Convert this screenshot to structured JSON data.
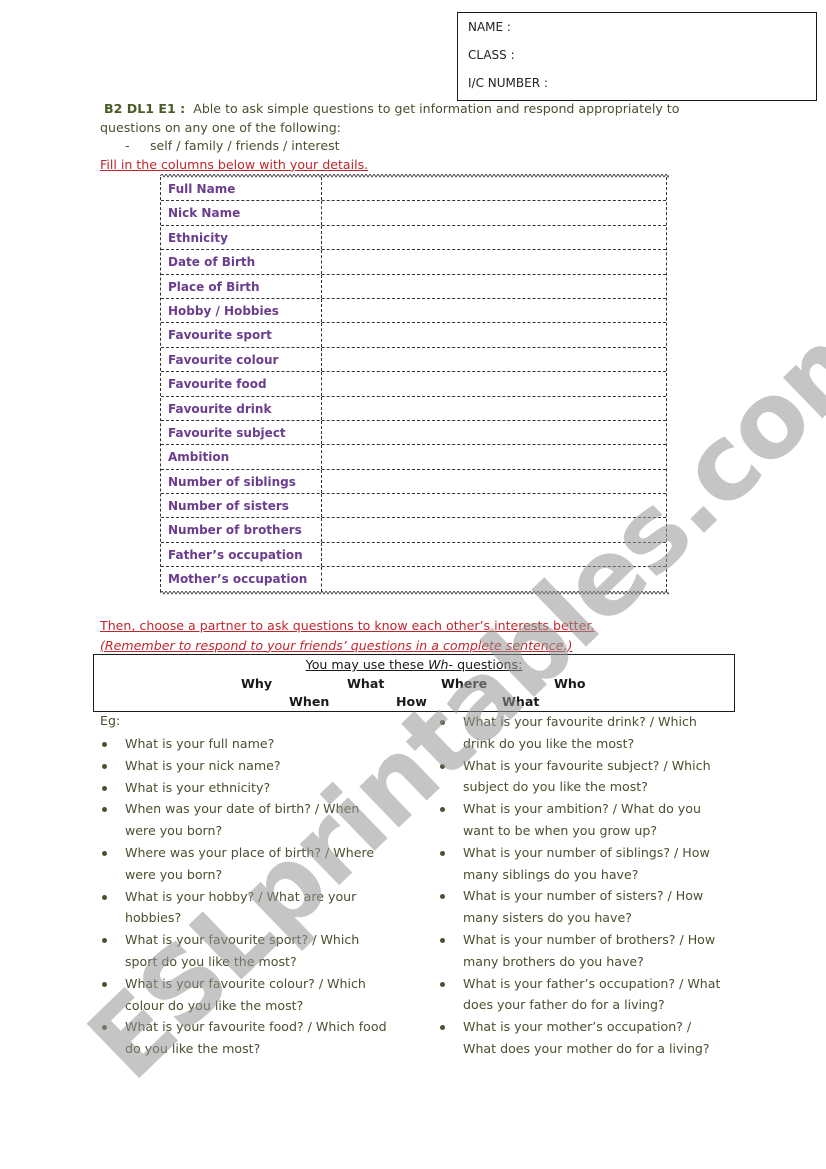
{
  "id_box": {
    "name_label": "NAME :",
    "class_label": "CLASS :",
    "ic_label": "I/C NUMBER :"
  },
  "intro": {
    "code": "B2 DL1 E1 :",
    "description": "Able to ask simple questions to get information and respond appropriately to questions on any one of the following:",
    "dash": "-",
    "topics": "self  / family / friends / interest",
    "instruction": "Fill in the columns below with your details."
  },
  "details_table": {
    "rows": [
      {
        "label": "Full Name",
        "value": ""
      },
      {
        "label": "Nick Name",
        "value": ""
      },
      {
        "label": "Ethnicity",
        "value": ""
      },
      {
        "label": "Date of Birth",
        "value": ""
      },
      {
        "label": "Place of Birth",
        "value": ""
      },
      {
        "label": "Hobby / Hobbies",
        "value": ""
      },
      {
        "label": "Favourite sport",
        "value": ""
      },
      {
        "label": "Favourite colour",
        "value": ""
      },
      {
        "label": "Favourite food",
        "value": ""
      },
      {
        "label": "Favourite drink",
        "value": ""
      },
      {
        "label": "Favourite subject",
        "value": ""
      },
      {
        "label": "Ambition",
        "value": ""
      },
      {
        "label": "Number of siblings",
        "value": ""
      },
      {
        "label": "Number of sisters",
        "value": ""
      },
      {
        "label": "Number of brothers",
        "value": ""
      },
      {
        "label": "Father’s occupation",
        "value": ""
      },
      {
        "label": "Mother’s occupation",
        "value": ""
      }
    ]
  },
  "partner": {
    "line1": "Then, choose a partner to ask questions to know each other’s interests better.",
    "line2": "(Remember to respond to your friends’ questions in a complete sentence.)"
  },
  "wh_box": {
    "title_prefix": "You may use these ",
    "title_em": "Wh",
    "title_suffix": "- questions:",
    "words": [
      "Why",
      "What",
      "Where",
      "Who",
      "When",
      "How",
      "What"
    ]
  },
  "examples": {
    "label": "Eg:",
    "left": [
      "What is your full name?",
      "What is your nick name?",
      "What is your ethnicity?",
      "When was your date of birth? / When were you born?",
      "Where was your place of birth? / Where were you born?",
      "What is your hobby? / What are your hobbies?",
      "What is your favourite sport? / Which sport do you like the most?",
      "What is your favourite colour? / Which colour do you like the most?",
      "What is your favourite food? / Which food do you like the most?"
    ],
    "right": [
      "What is your favourite drink? / Which drink do you like the most?",
      "What is your favourite subject? / Which subject do you like the most?",
      "What is your ambition? / What do you want to be when you grow up?",
      "What is your number of siblings? / How many siblings do you have?",
      "What is your number of sisters? / How many sisters do you have?",
      "What is your number of brothers? / How many brothers do you have?",
      "What is your father’s occupation? / What does your father do for a living?",
      "What is your mother’s occupation? / What does your mother do for a living?"
    ]
  },
  "watermark": {
    "text": "ESLprintables.com"
  },
  "colors": {
    "label_purple": "#6a3d8f",
    "instruction_red": "#c0272d",
    "body_text": "#4e4e30",
    "code_green": "#4b5a28",
    "watermark_gray": "#969696"
  }
}
